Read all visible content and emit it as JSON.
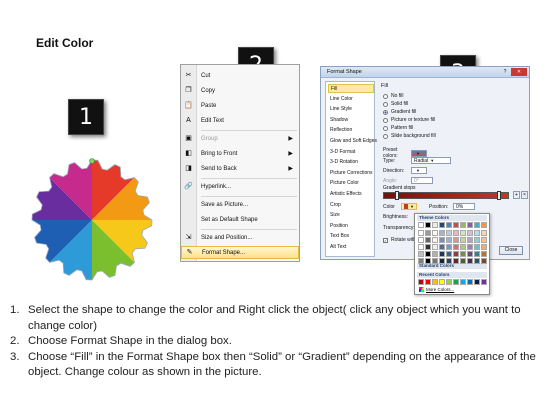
{
  "page": {
    "title": "Edit Color"
  },
  "badges": [
    "1",
    "2",
    "3"
  ],
  "gear": {
    "colors": [
      "#e53a2a",
      "#f39a15",
      "#f6c81a",
      "#7cbf2e",
      "#2f9ad8",
      "#1e5fb4",
      "#6a2da0",
      "#c52a8c"
    ]
  },
  "context_menu": {
    "items": [
      {
        "label": "Cut",
        "icon": "scissors-icon",
        "glyph": "✂",
        "enabled": true,
        "submenu": false
      },
      {
        "label": "Copy",
        "icon": "copy-icon",
        "glyph": "❐",
        "enabled": true,
        "submenu": false
      },
      {
        "label": "Paste",
        "icon": "paste-icon",
        "glyph": "📋",
        "enabled": true,
        "submenu": false
      },
      {
        "label": "Edit Text",
        "icon": "edit-text-icon",
        "glyph": "A",
        "enabled": true,
        "submenu": false
      },
      {
        "label": "Group",
        "icon": "group-icon",
        "glyph": "▣",
        "enabled": false,
        "submenu": true
      },
      {
        "label": "Bring to Front",
        "icon": "bring-front-icon",
        "glyph": "◧",
        "enabled": true,
        "submenu": true
      },
      {
        "label": "Send to Back",
        "icon": "send-back-icon",
        "glyph": "◨",
        "enabled": true,
        "submenu": true
      },
      {
        "label": "Hyperlink...",
        "icon": "hyperlink-icon",
        "glyph": "🔗",
        "enabled": true,
        "submenu": false
      },
      {
        "label": "Save as Picture...",
        "icon": "",
        "glyph": "",
        "enabled": true,
        "submenu": false
      },
      {
        "label": "Set as Default Shape",
        "icon": "",
        "glyph": "",
        "enabled": true,
        "submenu": false
      },
      {
        "label": "Size and Position...",
        "icon": "size-position-icon",
        "glyph": "⇲",
        "enabled": true,
        "submenu": false
      },
      {
        "label": "Format Shape...",
        "icon": "format-shape-icon",
        "glyph": "✎",
        "enabled": true,
        "submenu": false,
        "highlighted": true
      }
    ]
  },
  "dialog": {
    "title": "Format Shape",
    "close": "✕",
    "help": "?",
    "categories": [
      "Fill",
      "Line Color",
      "Line Style",
      "Shadow",
      "Reflection",
      "Glow and Soft Edges",
      "3-D Format",
      "3-D Rotation",
      "Picture Corrections",
      "Picture Color",
      "Artistic Effects",
      "Crop",
      "Size",
      "Position",
      "Text Box",
      "Alt Text"
    ],
    "selected_category": "Fill",
    "section": "Fill",
    "options": [
      "No fill",
      "Solid fill",
      "Gradient fill",
      "Picture or texture fill",
      "Pattern fill",
      "Slide background fill"
    ],
    "selected_option": "Gradient fill",
    "preset_label": "Preset colors:",
    "type_label": "Type:",
    "type_value": "Radial",
    "direction_label": "Direction:",
    "angle_label": "Angle:",
    "angle_value": "0°",
    "stops_label": "Gradient stops",
    "color_label": "Color",
    "position_label": "Position:",
    "position_value": "0%",
    "brightness_label": "Brightness:",
    "transparency_label": "Transparency:",
    "rotate_label": "Rotate with shape",
    "close_button": "Close"
  },
  "color_popup": {
    "theme_header": "Theme Colors",
    "standard_header": "Standard Colors",
    "recent_header": "Recent Colors",
    "more": "More Colors...",
    "theme_top": [
      "#ffffff",
      "#000000",
      "#eeece1",
      "#1f497d",
      "#4f81bd",
      "#c0504d",
      "#9bbb59",
      "#8064a2",
      "#4bacc6",
      "#f79646"
    ],
    "standard": [
      "#c00000",
      "#ff0000",
      "#ffc000",
      "#ffff00",
      "#92d050",
      "#00b050",
      "#00b0f0",
      "#0070c0",
      "#002060",
      "#7030a0"
    ],
    "recent": [
      "#7a0c0c",
      "#c0392b",
      "#333333",
      "#e67e22",
      "#1e5fb4",
      "#f6c81a",
      "#2ecc71",
      "#8e44ad"
    ]
  },
  "instructions": [
    {
      "num": "1.",
      "text": "Select the shape to change the color and Right click the object( click any object which you want to change color)"
    },
    {
      "num": "2.",
      "text": "Choose Format Shape in the dialog box."
    },
    {
      "num": "3.",
      "text": "Choose “Fill” in the Format Shape box then “Solid” or “Gradient” depending on the appearance of the object. Change colour as shown in the picture."
    }
  ]
}
